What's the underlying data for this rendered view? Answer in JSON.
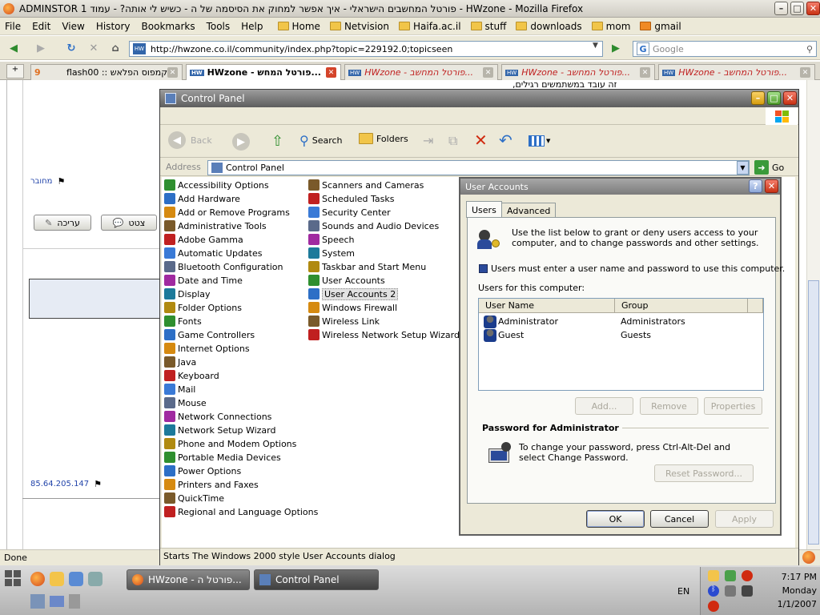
{
  "firefox": {
    "title": "ADMINSTOR 1 פורטל המחשבים הישראלי - איך אפשר למחוק את הסיסמה של ה - כשיש לי אותה? - עמוד - HWzone - Mozilla Firefox",
    "menus": [
      "File",
      "Edit",
      "View",
      "History",
      "Bookmarks",
      "Tools",
      "Help"
    ],
    "bookmarks": [
      "Home",
      "Netvision",
      "Haifa.ac.il",
      "stuff",
      "downloads",
      "mom",
      "gmail"
    ],
    "url": "http://hwzone.co.il/community/index.php?topic=229192.0;topicseen",
    "search_placeholder": "Google",
    "tabs": [
      {
        "label": "קמפוס הפלאש :: flash00",
        "active": false
      },
      {
        "label": "HWzone - פורטל המחש...",
        "active": true
      },
      {
        "label": "HWzone - פורטל המחשב...",
        "active": false
      },
      {
        "label": "HWzone - פורטל המחשב...",
        "active": false
      },
      {
        "label": "HWzone - פורטל המחשב...",
        "active": false
      }
    ],
    "status": "Done"
  },
  "forum": {
    "snippet": "זה עובד במשתמשים רגילים,",
    "offline_label": "מחובר",
    "edit_button": "עריכה",
    "quote_button": "צטט",
    "ip": "85.64.205.147"
  },
  "control_panel": {
    "title": "Control Panel",
    "toolbar": {
      "back": "Back",
      "search": "Search",
      "folders": "Folders"
    },
    "address_label": "Address",
    "address_value": "Control Panel",
    "go": "Go",
    "col1": [
      "Accessibility Options",
      "Add Hardware",
      "Add or Remove Programs",
      "Administrative Tools",
      "Adobe Gamma",
      "Automatic Updates",
      "Bluetooth Configuration",
      "Date and Time",
      "Display",
      "Folder Options",
      "Fonts",
      "Game Controllers",
      "Internet Options",
      "Java",
      "Keyboard",
      "Mail",
      "Mouse",
      "Network Connections",
      "Network Setup Wizard",
      "Phone and Modem Options",
      "Portable Media Devices",
      "Power Options",
      "Printers and Faxes",
      "QuickTime",
      "Regional and Language Options"
    ],
    "col2": [
      "Scanners and Cameras",
      "Scheduled Tasks",
      "Security Center",
      "Sounds and Audio Devices",
      "Speech",
      "System",
      "Taskbar and Start Menu",
      "User Accounts",
      "User Accounts 2",
      "Windows Firewall",
      "Wireless Link",
      "Wireless Network Setup Wizard"
    ],
    "status": "Starts The Windows 2000 style User Accounts dialog"
  },
  "dialog": {
    "title": "User Accounts",
    "tabs": [
      "Users",
      "Advanced"
    ],
    "intro": "Use the list below to grant or deny users access to your computer, and to change passwords and other settings.",
    "checkbox_label": "Users must enter a user name and password to use this computer.",
    "users_label": "Users for this computer:",
    "columns": [
      "User Name",
      "Group"
    ],
    "users": [
      {
        "name": "Administrator",
        "group": "Administrators"
      },
      {
        "name": "Guest",
        "group": "Guests"
      }
    ],
    "buttons": {
      "add": "Add...",
      "remove": "Remove",
      "properties": "Properties"
    },
    "password_heading": "Password for Administrator",
    "password_text": "To change your password, press Ctrl-Alt-Del and select Change Password.",
    "reset": "Reset Password...",
    "ok": "OK",
    "cancel": "Cancel",
    "apply": "Apply"
  },
  "taskbar": {
    "items": [
      "HWzone - פורטל ה...",
      "Control Panel"
    ],
    "lang": "EN",
    "time": "7:17 PM",
    "day": "Monday",
    "date": "1/1/2007"
  }
}
